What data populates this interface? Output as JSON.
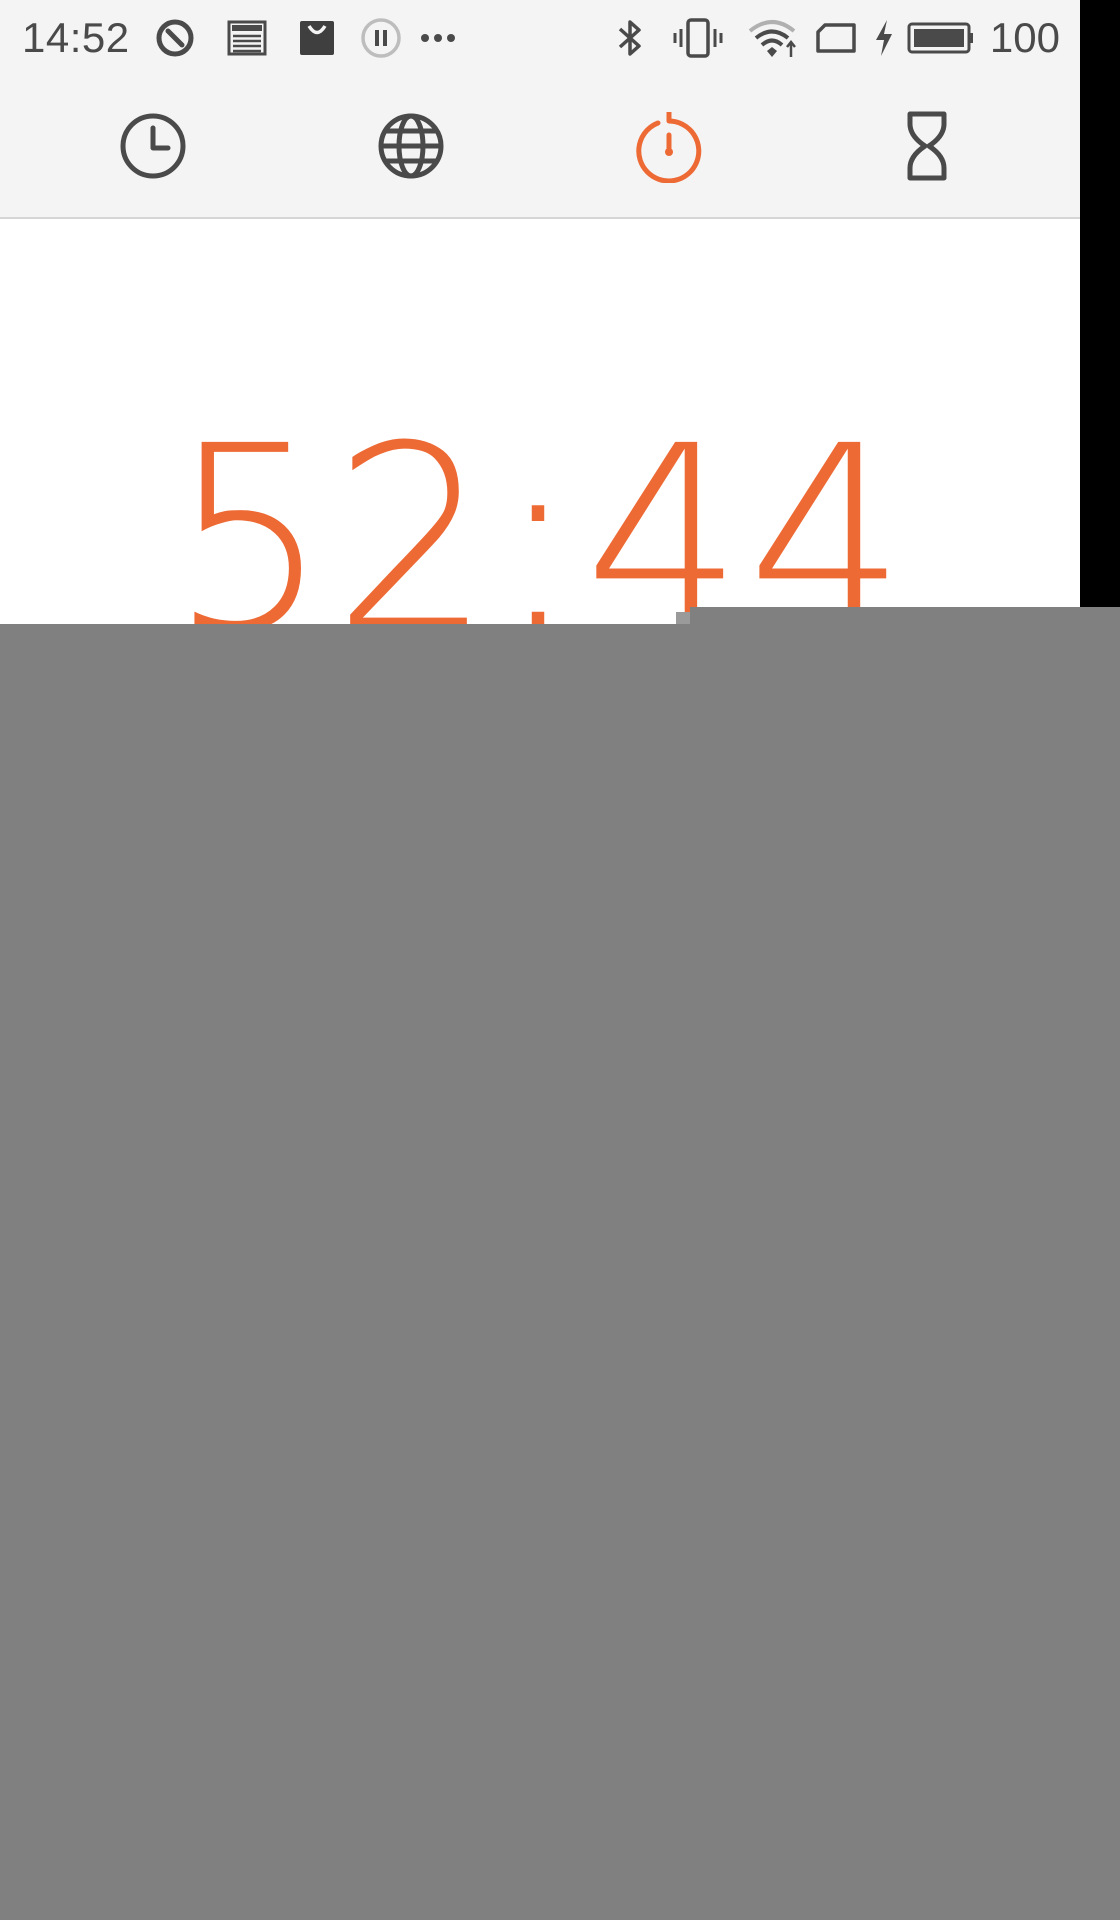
{
  "status_bar": {
    "time": "14:52",
    "battery_level": "100",
    "left_icons": [
      "compass-icon",
      "news-icon",
      "shopping-bag-icon",
      "pause-icon",
      "more-dots-icon"
    ],
    "right_icons": [
      "bluetooth-icon",
      "vibrate-icon",
      "wifi-icon",
      "sim-icon",
      "charging-icon",
      "battery-icon"
    ]
  },
  "tabs": [
    {
      "name": "clock",
      "icon": "clock-icon",
      "active": false
    },
    {
      "name": "world-clock",
      "icon": "globe-icon",
      "active": false
    },
    {
      "name": "stopwatch",
      "icon": "stopwatch-icon",
      "active": true
    },
    {
      "name": "timer",
      "icon": "hourglass-icon",
      "active": false
    }
  ],
  "stopwatch": {
    "display": "52:44"
  },
  "colors": {
    "accent": "#ee6a35",
    "icon": "#4a4a4a",
    "bar_background": "#f4f4f4",
    "overlay": "#808080"
  }
}
